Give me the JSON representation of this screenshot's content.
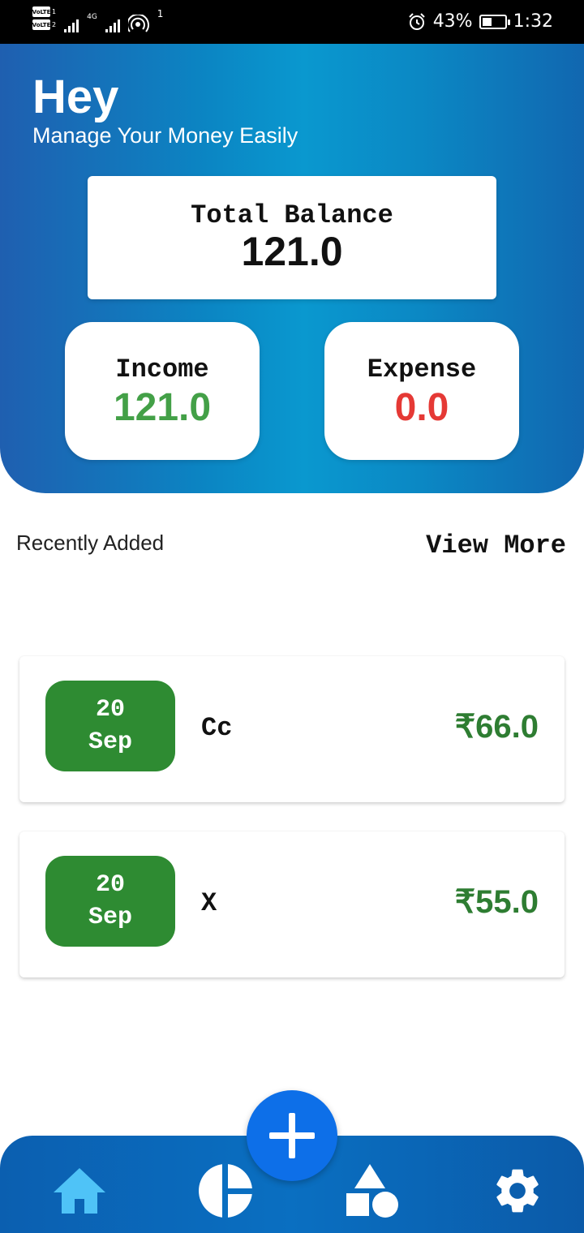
{
  "status_bar": {
    "sim1": "VoLTE",
    "sim1_num": "1",
    "sim2": "VoLTE",
    "sim2_num": "2",
    "network": "4G",
    "hotspot_count": "1",
    "battery": "43%",
    "battery_level": 0.43,
    "time": "1:32"
  },
  "header": {
    "greeting": "Hey",
    "subtitle": "Manage Your Money Easily",
    "balance_label": "Total Balance",
    "balance_value": "121.0",
    "income_label": "Income",
    "income_value": "121.0",
    "expense_label": "Expense",
    "expense_value": "0.0"
  },
  "recent": {
    "title": "Recently Added",
    "view_more": "View More",
    "transactions": [
      {
        "day": "20",
        "month": "Sep",
        "title": "Cc",
        "amount": "₹66.0"
      },
      {
        "day": "20",
        "month": "Sep",
        "title": "X",
        "amount": "₹55.0"
      }
    ]
  },
  "nav": {
    "items": [
      {
        "icon": "home-icon",
        "color": "#4fc3f7"
      },
      {
        "icon": "pie-chart-icon",
        "color": "#ffffff"
      },
      {
        "icon": "shapes-icon",
        "color": "#ffffff"
      },
      {
        "icon": "gear-icon",
        "color": "#ffffff"
      }
    ],
    "fab_icon": "plus-icon"
  },
  "colors": {
    "income": "#43a047",
    "expense": "#e53935",
    "amount": "#2e7d32",
    "date_badge": "#2e8b32",
    "fab": "#0d6fe8"
  }
}
